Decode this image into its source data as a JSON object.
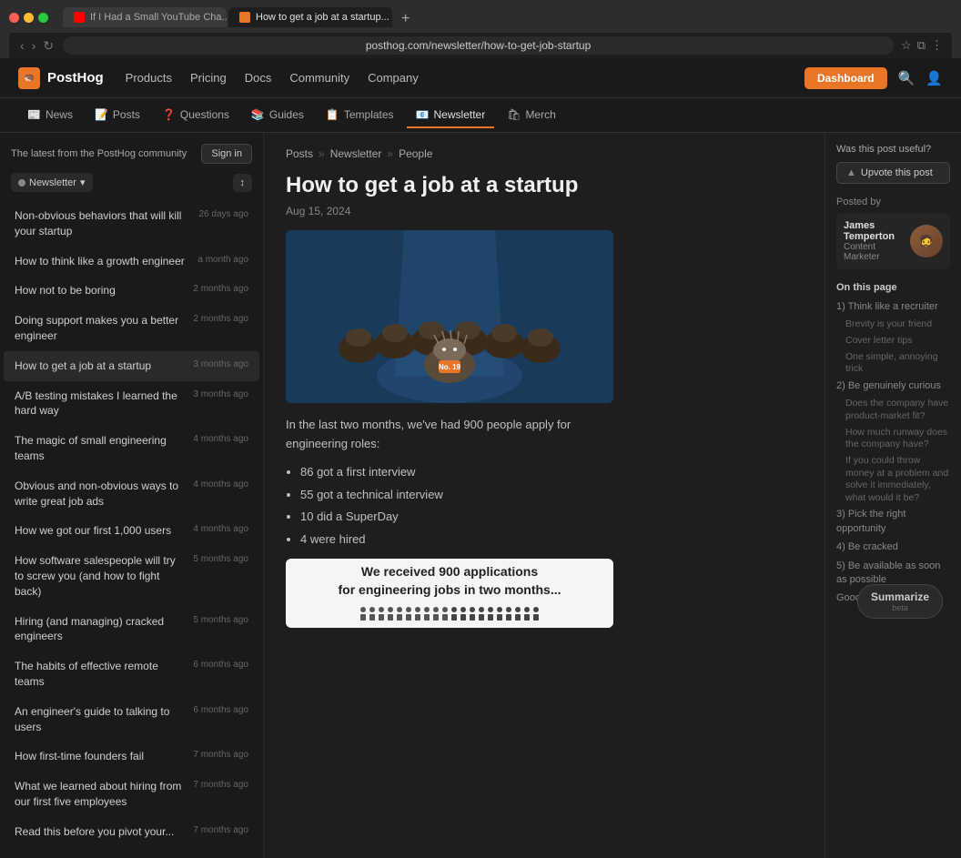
{
  "browser": {
    "tabs": [
      {
        "id": "tab1",
        "favicon_type": "yt",
        "title": "If I Had a Small YouTube Cha...",
        "active": false
      },
      {
        "id": "tab2",
        "favicon_type": "ph",
        "title": "How to get a job at a startup...",
        "active": true
      }
    ],
    "new_tab_label": "+",
    "url": "posthog.com/newsletter/how-to-get-job-startup",
    "back_label": "‹",
    "forward_label": "›",
    "refresh_label": "↻"
  },
  "top_nav": {
    "logo": "PostHog",
    "links": [
      "Products",
      "Pricing",
      "Docs",
      "Community",
      "Company"
    ],
    "dashboard_label": "Dashboard"
  },
  "secondary_nav": {
    "items": [
      {
        "icon": "📰",
        "label": "News"
      },
      {
        "icon": "📝",
        "label": "Posts"
      },
      {
        "icon": "❓",
        "label": "Questions"
      },
      {
        "icon": "📚",
        "label": "Guides"
      },
      {
        "icon": "📋",
        "label": "Templates"
      },
      {
        "icon": "📧",
        "label": "Newsletter",
        "active": true
      },
      {
        "icon": "🛍",
        "label": "Merch"
      }
    ]
  },
  "sidebar": {
    "header_text": "The latest from the PostHog community",
    "sign_in_label": "Sign in",
    "newsletter_selector_label": "Newsletter",
    "sort_label": "↕",
    "items": [
      {
        "title": "Non-obvious behaviors that will kill your startup",
        "date": "26 days ago"
      },
      {
        "title": "How to think like a growth engineer",
        "date": "a month ago"
      },
      {
        "title": "How not to be boring",
        "date": "2 months ago"
      },
      {
        "title": "Doing support makes you a better engineer",
        "date": "2 months ago"
      },
      {
        "title": "How to get a job at a startup",
        "date": "3 months ago",
        "active": true
      },
      {
        "title": "A/B testing mistakes I learned the hard way",
        "date": "3 months ago"
      },
      {
        "title": "The magic of small engineering teams",
        "date": "4 months ago"
      },
      {
        "title": "Obvious and non-obvious ways to write great job ads",
        "date": "4 months ago"
      },
      {
        "title": "How we got our first 1,000 users",
        "date": "4 months ago"
      },
      {
        "title": "How software salespeople will try to screw you (and how to fight back)",
        "date": "5 months ago"
      },
      {
        "title": "Hiring (and managing) cracked engineers",
        "date": "5 months ago"
      },
      {
        "title": "The habits of effective remote teams",
        "date": "6 months ago"
      },
      {
        "title": "An engineer's guide to talking to users",
        "date": "6 months ago"
      },
      {
        "title": "How first-time founders fail",
        "date": "7 months ago"
      },
      {
        "title": "What we learned about hiring from our first five employees",
        "date": "7 months ago"
      },
      {
        "title": "Read this before you pivot your...",
        "date": "7 months ago"
      }
    ]
  },
  "article": {
    "breadcrumbs": [
      "Posts",
      "Newsletter",
      "People"
    ],
    "title": "How to get a job at a startup",
    "date": "Aug 15, 2024",
    "intro": "In the last two months, we've had 900 people apply for engineering roles:",
    "bullet_points": [
      "86 got a first interview",
      "55 got a technical interview",
      "10 did a SuperDay",
      "4 were hired"
    ],
    "superday_link": "SuperDay"
  },
  "infographic": {
    "line1": "We received 900 applications",
    "line2": "for engineering jobs in two months..."
  },
  "right_sidebar": {
    "useful_label": "Was this post useful?",
    "upvote_label": "Upvote this post",
    "posted_by_label": "Posted by",
    "author": {
      "name": "James Temperton",
      "role": "Content Marketer"
    },
    "on_page_label": "On this page",
    "sections": [
      {
        "title": "1) Think like a recruiter",
        "subsections": [
          "Brevity is your friend",
          "Cover letter tips",
          "One simple, annoying trick"
        ]
      },
      {
        "title": "2) Be genuinely curious",
        "subsections": [
          "Does the company have product-market fit?",
          "How much runway does the company have?",
          "If you could throw money at a problem and solve it immediately, what would it be?"
        ]
      },
      {
        "title": "3) Pick the right opportunity",
        "subsections": []
      },
      {
        "title": "4) Be cracked",
        "subsections": []
      },
      {
        "title": "5) Be available as soon as possible",
        "subsections": []
      },
      {
        "title": "Good reads 📖",
        "subsections": []
      }
    ]
  },
  "summarize": {
    "label": "Summarize",
    "sub": "beta"
  }
}
